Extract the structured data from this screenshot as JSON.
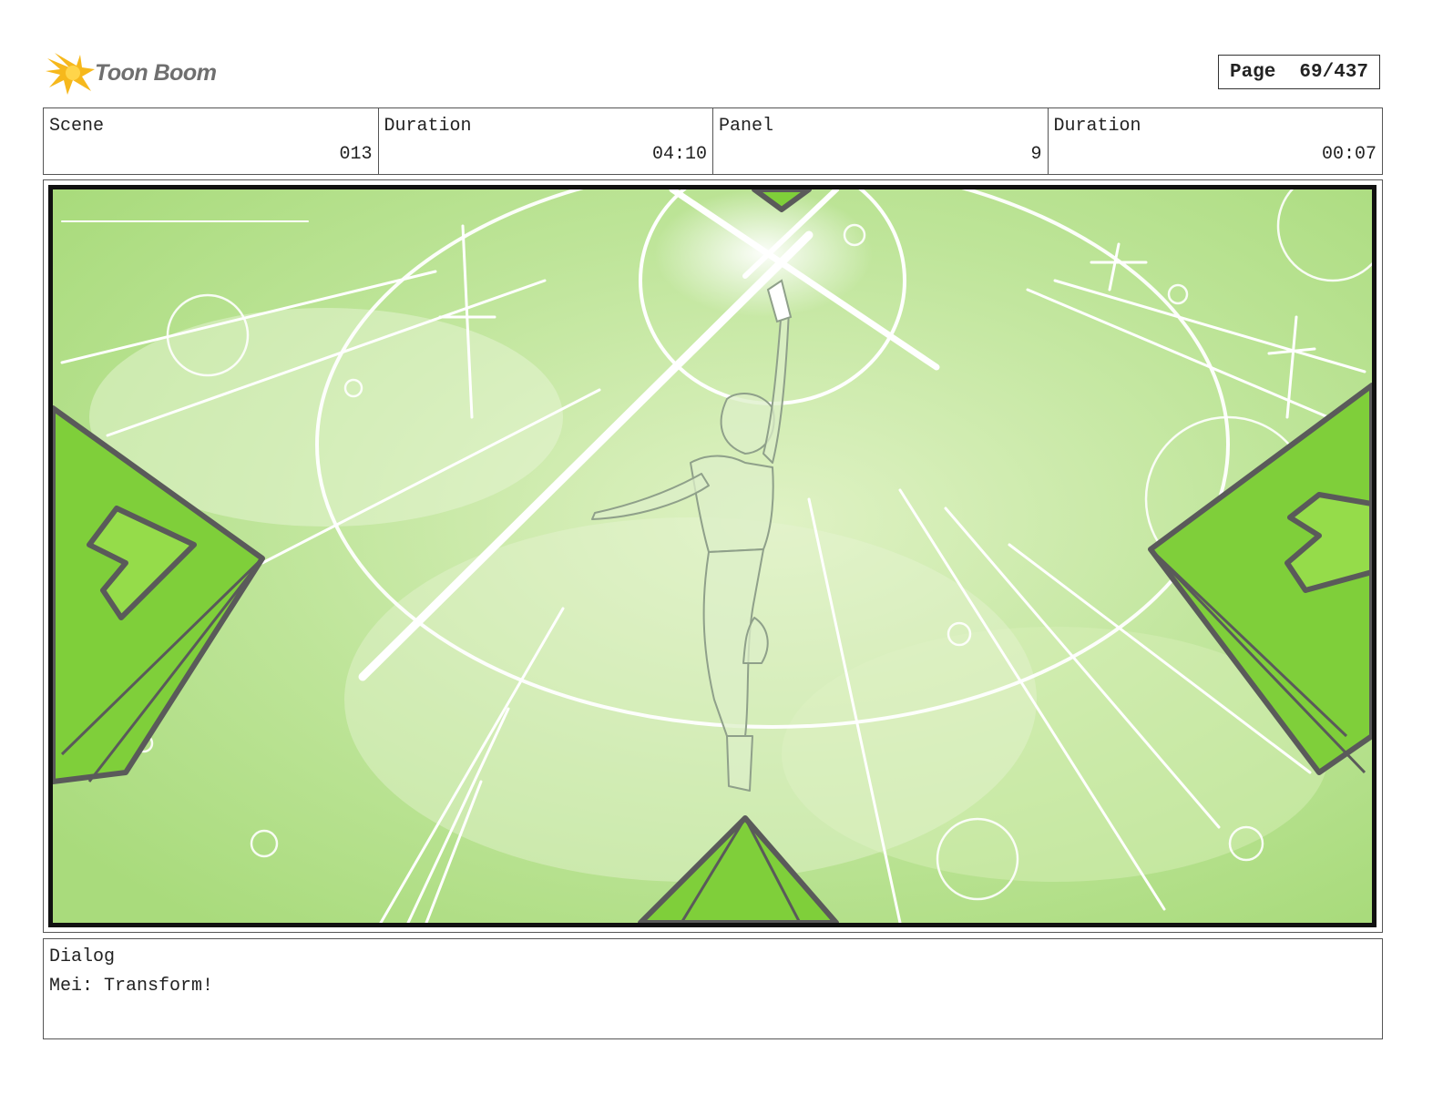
{
  "header": {
    "logo_text": "Toon Boom",
    "page_label": "Page",
    "page_value": "69/437"
  },
  "info": {
    "scene_label": "Scene",
    "scene_value": "013",
    "duration_label": "Duration",
    "duration_value": "04:10",
    "panel_label": "Panel",
    "panel_value": "9",
    "panel_duration_label": "Duration",
    "panel_duration_value": "00:07"
  },
  "dialog": {
    "label": "Dialog",
    "text": "Mei: Transform!"
  },
  "colors": {
    "panel_background": "#b8e08e",
    "crystal_green": "#7fcf3a",
    "logo_accent": "#f6b81c"
  }
}
